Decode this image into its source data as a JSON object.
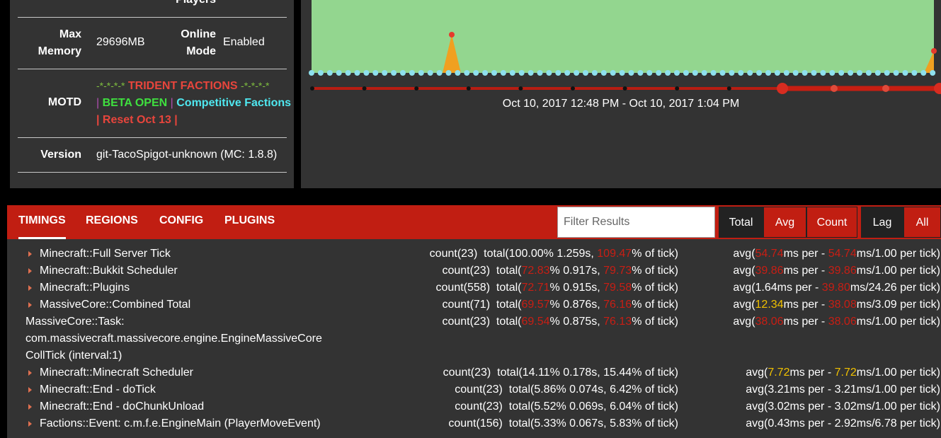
{
  "info": {
    "players_label": "Players",
    "max_memory_label": "Max Memory",
    "max_memory_value": "29696MB",
    "online_mode_label": "Online Mode",
    "online_mode_value": "Enabled",
    "motd_label": "MOTD",
    "motd": {
      "line1_prefix": "-*-*-*-*",
      "line1_title": "TRIDENT FACTIONS",
      "line1_suffix": "-*-*-*-*",
      "line2_bar": "|",
      "line2_beta": "BETA OPEN",
      "line2_bar2": "|",
      "line2_comp": "Competitive Factions",
      "line3": "| Reset Oct 13 |"
    },
    "version_label": "Version",
    "version_value": "git-TacoSpigot-unknown (MC: 1.8.8)"
  },
  "graph": {
    "range_label": "Oct 10, 2017 12:48 PM - Oct 10, 2017 1:04 PM",
    "colors": {
      "area": "#93d68f",
      "spike": "#f0a020",
      "points": "#8ee0ee",
      "timeline": "#c01e12"
    }
  },
  "tabs": [
    {
      "label": "TIMINGS"
    },
    {
      "label": "REGIONS"
    },
    {
      "label": "CONFIG"
    },
    {
      "label": "PLUGINS"
    }
  ],
  "filter": {
    "placeholder": "Filter Results",
    "value": ""
  },
  "sort_buttons": [
    {
      "label": "Total"
    },
    {
      "label": "Avg"
    },
    {
      "label": "Count"
    }
  ],
  "mode_buttons": [
    {
      "label": "Lag"
    },
    {
      "label": "All"
    }
  ],
  "timings": [
    {
      "name": "Minecraft::Full Server Tick",
      "count": "count(23)",
      "t_pre": "total(100.00% 1.259s, ",
      "t_pct": "",
      "t_mid": "",
      "t_tick": "109.47",
      "t_post": "% of tick)",
      "a_pre": "avg(",
      "a_v1": "54.74",
      "a_mid": "ms per - ",
      "a_v2": "54.74",
      "a_post": "ms/1.00 per tick)",
      "a_v1c": "red",
      "a_v2c": "red"
    },
    {
      "name": "Minecraft::Bukkit Scheduler",
      "count": "count(23)",
      "t_pre": "total(",
      "t_pct": "72.83",
      "t_mid": "% 0.917s, ",
      "t_tick": "79.73",
      "t_post": "% of tick)",
      "a_pre": "avg(",
      "a_v1": "39.86",
      "a_mid": "ms per - ",
      "a_v2": "39.86",
      "a_post": "ms/1.00 per tick)",
      "a_v1c": "red",
      "a_v2c": "red"
    },
    {
      "name": "Minecraft::Plugins",
      "count": "count(558)",
      "t_pre": "total(",
      "t_pct": "72.71",
      "t_mid": "% 0.915s, ",
      "t_tick": "79.58",
      "t_post": "% of tick)",
      "a_pre": "avg(",
      "a_v1": "",
      "a_mid": "1.64ms per - ",
      "a_v2": "39.80",
      "a_post": "ms/24.26 per tick)",
      "a_v1c": "",
      "a_v2c": "red"
    },
    {
      "name": "MassiveCore::Combined Total",
      "count": "count(71)",
      "t_pre": "total(",
      "t_pct": "69.57",
      "t_mid": "% 0.876s, ",
      "t_tick": "76.16",
      "t_post": "% of tick)",
      "a_pre": "avg(",
      "a_v1": "12.34",
      "a_mid": "ms per - ",
      "a_v2": "38.08",
      "a_post": "ms/3.09 per tick)",
      "a_v1c": "yel",
      "a_v2c": "red"
    },
    {
      "name": "MassiveCore::Task: com.massivecraft.massivecore.engine.EngineMassiveCore CollTick (interval:1)",
      "count": "count(23)",
      "t_pre": "total(",
      "t_pct": "69.54",
      "t_mid": "% 0.875s, ",
      "t_tick": "76.13",
      "t_post": "% of tick)",
      "a_pre": "avg(",
      "a_v1": "38.06",
      "a_mid": "ms per - ",
      "a_v2": "38.06",
      "a_post": "ms/1.00 per tick)",
      "a_v1c": "red",
      "a_v2c": "red"
    },
    {
      "name": "Minecraft::Minecraft Scheduler",
      "count": "count(23)",
      "t_pre": "total(14.11% 0.178s, 15.44% of tick)",
      "t_pct": "",
      "t_mid": "",
      "t_tick": "",
      "t_post": "",
      "a_pre": "avg(",
      "a_v1": "7.72",
      "a_mid": "ms per - ",
      "a_v2": "7.72",
      "a_post": "ms/1.00 per tick)",
      "a_v1c": "yel",
      "a_v2c": "yel"
    },
    {
      "name": "Minecraft::End - doTick",
      "count": "count(23)",
      "t_pre": "total(5.86% 0.074s, 6.42% of tick)",
      "t_pct": "",
      "t_mid": "",
      "t_tick": "",
      "t_post": "",
      "a_pre": "avg(3.21ms per - 3.21ms/1.00 per tick)",
      "a_v1": "",
      "a_mid": "",
      "a_v2": "",
      "a_post": "",
      "a_v1c": "",
      "a_v2c": ""
    },
    {
      "name": "Minecraft::End - doChunkUnload",
      "count": "count(23)",
      "t_pre": "total(5.52% 0.069s, 6.04% of tick)",
      "t_pct": "",
      "t_mid": "",
      "t_tick": "",
      "t_post": "",
      "a_pre": "avg(3.02ms per - 3.02ms/1.00 per tick)",
      "a_v1": "",
      "a_mid": "",
      "a_v2": "",
      "a_post": "",
      "a_v1c": "",
      "a_v2c": ""
    },
    {
      "name": "Factions::Event: c.m.f.e.EngineMain (PlayerMoveEvent)",
      "count": "count(156)",
      "t_pre": "total(5.33% 0.067s, 5.83% of tick)",
      "t_pct": "",
      "t_mid": "",
      "t_tick": "",
      "t_post": "",
      "a_pre": "avg(0.43ms per - 2.92ms/6.78 per tick)",
      "a_v1": "",
      "a_mid": "",
      "a_v2": "",
      "a_post": "",
      "a_v1c": "",
      "a_v2c": ""
    }
  ]
}
